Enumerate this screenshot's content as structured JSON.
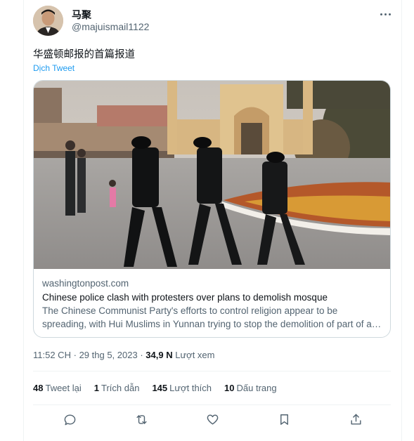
{
  "author": {
    "name": "马聚",
    "handle": "@majuismail1122"
  },
  "tweet": {
    "text": "华盛顿邮报的首篇报道",
    "translate_label": "Dịch Tweet"
  },
  "card": {
    "domain": "washingtonpost.com",
    "title": "Chinese police clash with protesters over plans to demolish mosque",
    "description": "The Chinese Communist Party's efforts to control religion appear to be spreading, with Hui Muslims in Yunnan trying to stop the demolition of part of a mosque"
  },
  "meta": {
    "time": "11:52 CH",
    "date": "29 thg 5, 2023",
    "separator": "·",
    "views_count": "34,9 N",
    "views_label": "Lượt xem"
  },
  "stats": {
    "retweets": {
      "count": "48",
      "label": "Tweet lại"
    },
    "quotes": {
      "count": "1",
      "label": "Trích dẫn"
    },
    "likes": {
      "count": "145",
      "label": "Lượt thích"
    },
    "bookmarks": {
      "count": "10",
      "label": "Dấu trang"
    }
  },
  "actions": [
    "reply-icon",
    "retweet-icon",
    "like-icon",
    "bookmark-icon",
    "share-icon"
  ],
  "colors": {
    "accent": "#1d9bf0",
    "text": "#0f1419",
    "secondary": "#536471",
    "border": "#cfd9de"
  }
}
